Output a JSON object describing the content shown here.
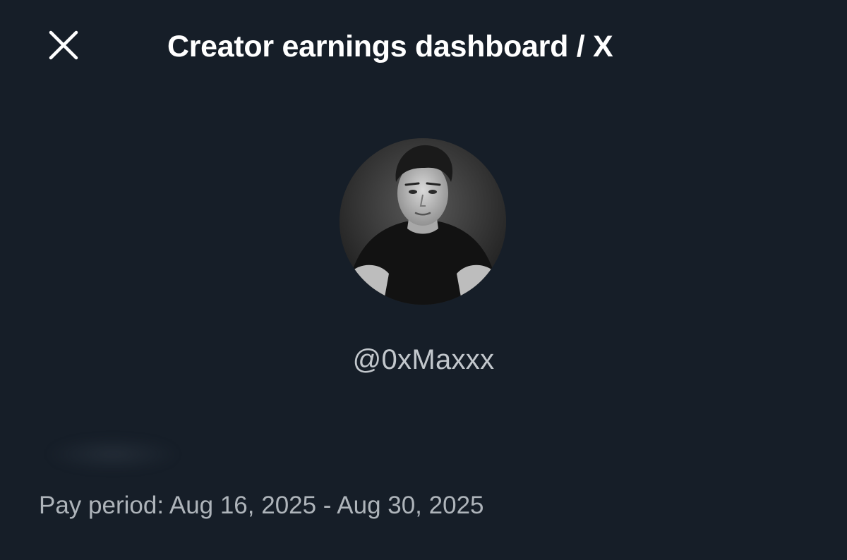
{
  "header": {
    "close_icon": "close-icon",
    "title": "Creator earnings dashboard / X"
  },
  "profile": {
    "avatar_icon": "profile-avatar",
    "handle": "@0xMaxxx"
  },
  "pay_period": {
    "text": "Pay period: Aug 16, 2025 - Aug 30, 2025"
  },
  "colors": {
    "background": "#161e28",
    "title": "#ffffff",
    "secondary_text": "#aeb4ba"
  }
}
